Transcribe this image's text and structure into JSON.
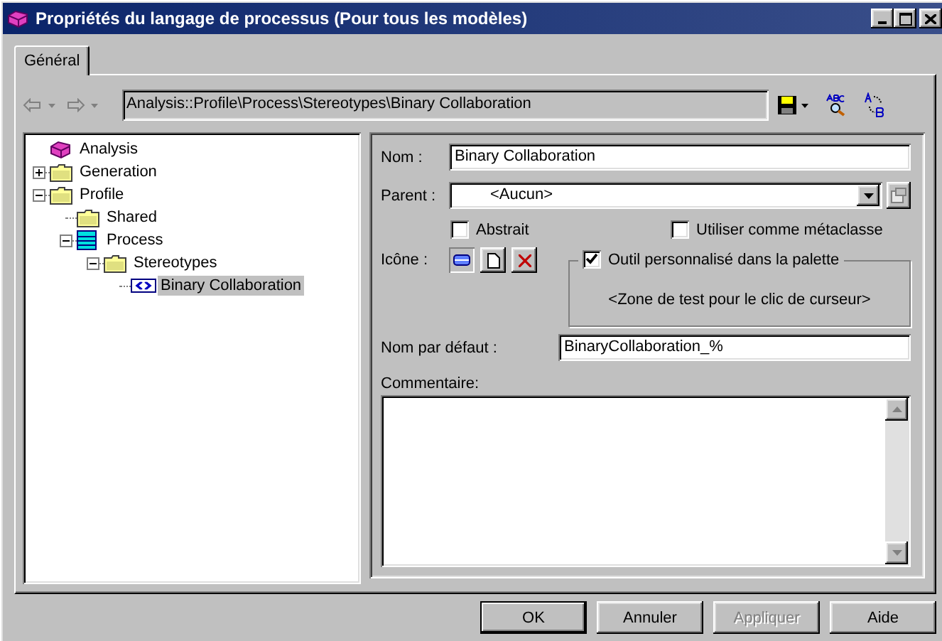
{
  "window": {
    "title": "Propriétés du langage de processus (Pour tous les modèles)"
  },
  "tabs": [
    {
      "label": "Général",
      "selected": true
    }
  ],
  "toolbar": {
    "path": "Analysis::Profile\\Process\\Stereotypes\\Binary Collaboration"
  },
  "tree": [
    {
      "label": "Analysis",
      "kind": "model",
      "selected": false,
      "children": [
        {
          "label": "Generation",
          "kind": "folder",
          "expanded": false,
          "selected": false
        },
        {
          "label": "Profile",
          "kind": "folder",
          "expanded": true,
          "selected": false,
          "children": [
            {
              "label": "Shared",
              "kind": "folder",
              "selected": false
            },
            {
              "label": "Process",
              "kind": "package",
              "expanded": true,
              "selected": false,
              "children": [
                {
                  "label": "Stereotypes",
                  "kind": "folder",
                  "expanded": true,
                  "selected": false,
                  "children": [
                    {
                      "label": "Binary Collaboration",
                      "kind": "stereotype",
                      "selected": true
                    }
                  ]
                }
              ]
            }
          ]
        }
      ]
    }
  ],
  "form": {
    "name": {
      "label": "Nom :",
      "value": "Binary Collaboration"
    },
    "parent": {
      "label": "Parent :",
      "value": "<Aucun>"
    },
    "checkboxes": [
      {
        "label": "Abstrait",
        "checked": false
      },
      {
        "label": "Utiliser comme métaclasse",
        "checked": false
      }
    ],
    "icon": {
      "label": "Icône :"
    },
    "palette_tool": {
      "label": "Outil personnalisé dans la palette",
      "checked": true,
      "text": "<Zone de test pour le clic de curseur>"
    },
    "default_name": {
      "label": "Nom par défaut :",
      "value": "BinaryCollaboration_%"
    },
    "comment": {
      "label": "Commentaire:"
    }
  },
  "buttons": [
    {
      "label": "OK",
      "disabled": false
    },
    {
      "label": "Annuler",
      "disabled": false
    },
    {
      "label": "Appliquer",
      "disabled": true
    },
    {
      "label": "Aide",
      "disabled": false
    }
  ]
}
